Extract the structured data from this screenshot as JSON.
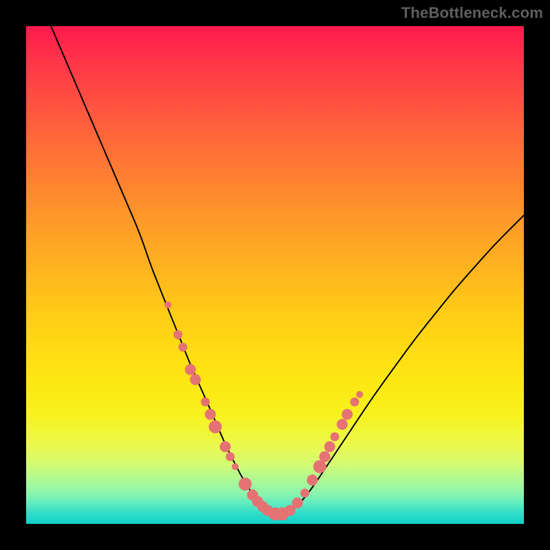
{
  "watermark": "TheBottleneck.com",
  "chart_data": {
    "type": "line",
    "title": "",
    "xlabel": "",
    "ylabel": "",
    "xlim": [
      0,
      100
    ],
    "ylim": [
      0,
      100
    ],
    "grid": false,
    "legend": false,
    "series": [
      {
        "name": "bottleneck-curve",
        "x": [
          5,
          8,
          11,
          14,
          17,
          20,
          23,
          25,
          27,
          29,
          31,
          33,
          35,
          37,
          38.5,
          40,
          41.5,
          43,
          44.5,
          46,
          48,
          50,
          52,
          54,
          56,
          58,
          60,
          63,
          66,
          70,
          74,
          78,
          82,
          86,
          90,
          94,
          98,
          100
        ],
        "y": [
          100,
          93,
          86,
          79,
          72,
          65,
          58,
          52,
          47,
          42,
          37,
          32,
          27.5,
          23,
          19.5,
          16,
          13,
          10,
          7.5,
          5.3,
          3.2,
          1.8,
          1.8,
          3.2,
          5.3,
          8,
          11,
          15.5,
          20,
          26,
          31.5,
          37,
          42,
          47,
          51.5,
          56,
          60,
          62
        ]
      }
    ],
    "markers": {
      "name": "data-points",
      "points": [
        {
          "x": 28.5,
          "y": 44,
          "size": "xs"
        },
        {
          "x": 30.5,
          "y": 38,
          "size": "sm"
        },
        {
          "x": 31.5,
          "y": 35.5,
          "size": "sm"
        },
        {
          "x": 33,
          "y": 31,
          "size": "md"
        },
        {
          "x": 34,
          "y": 29,
          "size": "md"
        },
        {
          "x": 36,
          "y": 24.5,
          "size": "sm"
        },
        {
          "x": 37,
          "y": 22,
          "size": "md"
        },
        {
          "x": 38,
          "y": 19.5,
          "size": "lg"
        },
        {
          "x": 40,
          "y": 15.5,
          "size": "md"
        },
        {
          "x": 41,
          "y": 13.5,
          "size": "sm"
        },
        {
          "x": 42,
          "y": 11.5,
          "size": "xs"
        },
        {
          "x": 44,
          "y": 8,
          "size": "lg"
        },
        {
          "x": 45.5,
          "y": 5.8,
          "size": "md"
        },
        {
          "x": 46.5,
          "y": 4.5,
          "size": "md"
        },
        {
          "x": 47.5,
          "y": 3.5,
          "size": "md"
        },
        {
          "x": 48.5,
          "y": 2.7,
          "size": "md"
        },
        {
          "x": 50,
          "y": 2.0,
          "size": "lg"
        },
        {
          "x": 51.5,
          "y": 2.0,
          "size": "lg"
        },
        {
          "x": 53,
          "y": 2.7,
          "size": "md"
        },
        {
          "x": 54.5,
          "y": 4.2,
          "size": "md"
        },
        {
          "x": 56,
          "y": 6.2,
          "size": "sm"
        },
        {
          "x": 57.5,
          "y": 8.8,
          "size": "md"
        },
        {
          "x": 59,
          "y": 11.5,
          "size": "lg"
        },
        {
          "x": 60,
          "y": 13.5,
          "size": "md"
        },
        {
          "x": 61,
          "y": 15.5,
          "size": "md"
        },
        {
          "x": 62,
          "y": 17.5,
          "size": "sm"
        },
        {
          "x": 63.5,
          "y": 20,
          "size": "md"
        },
        {
          "x": 64.5,
          "y": 22,
          "size": "md"
        },
        {
          "x": 66,
          "y": 24.5,
          "size": "sm"
        },
        {
          "x": 67,
          "y": 26,
          "size": "xs"
        }
      ]
    },
    "background_gradient": {
      "top": "#ff1a4d",
      "mid": "#ffe312",
      "bottom": "#0fd0c7"
    }
  }
}
